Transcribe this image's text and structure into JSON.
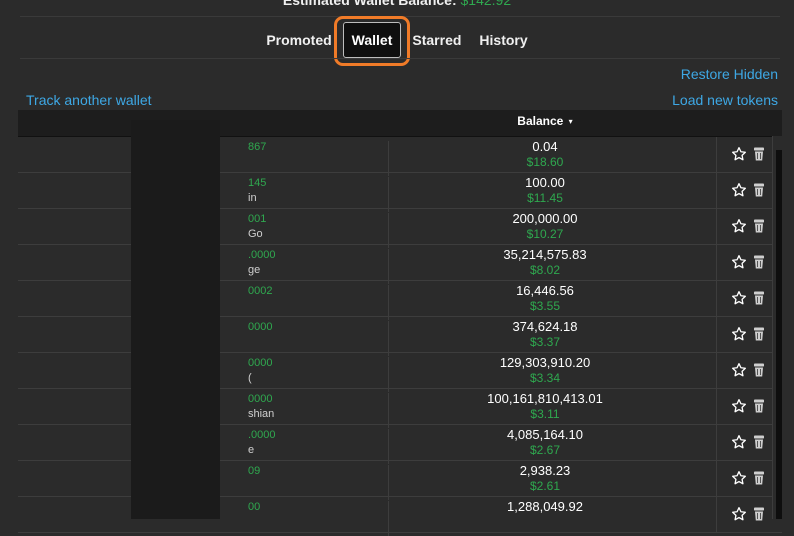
{
  "header": {
    "balance_label": "Estimated Wallet Balance:",
    "balance_value": "$142.92"
  },
  "tabs": [
    {
      "label": "Promoted"
    },
    {
      "label": "Wallet",
      "active": true
    },
    {
      "label": "Starred"
    },
    {
      "label": "History"
    }
  ],
  "links": {
    "restore_hidden": "Restore Hidden",
    "track_wallet": "Track another wallet",
    "load_tokens": "Load new tokens"
  },
  "table": {
    "balance_header": "Balance",
    "sort_caret": "▾",
    "rows": [
      {
        "addr": "867",
        "name": "",
        "balance": "0.04",
        "usd": "$18.60"
      },
      {
        "addr": "145",
        "name": "in",
        "balance": "100.00",
        "usd": "$11.45"
      },
      {
        "addr": "001",
        "name": "Go",
        "balance": "200,000.00",
        "usd": "$10.27"
      },
      {
        "addr": ".0000",
        "name": "ge",
        "balance": "35,214,575.83",
        "usd": "$8.02"
      },
      {
        "addr": "0002",
        "name": "",
        "balance": "16,446.56",
        "usd": "$3.55"
      },
      {
        "addr": "0000",
        "name": "",
        "balance": "374,624.18",
        "usd": "$3.37"
      },
      {
        "addr": "0000",
        "name": "(",
        "balance": "129,303,910.20",
        "usd": "$3.34"
      },
      {
        "addr": "0000",
        "name": "shian",
        "balance": "100,161,810,413.01",
        "usd": "$3.11"
      },
      {
        "addr": ".0000",
        "name": "e",
        "balance": "4,085,164.10",
        "usd": "$2.67"
      },
      {
        "addr": "09",
        "name": "",
        "balance": "2,938.23",
        "usd": "$2.61"
      },
      {
        "addr": "00",
        "name": "",
        "balance": "1,288,049.92",
        "usd": ""
      }
    ]
  },
  "icons": {
    "star": "star-outline-icon",
    "trash": "trash-icon"
  },
  "colors": {
    "accent_green": "#2fa84f",
    "link_blue": "#3ea8e5",
    "highlight_orange": "#f07b28"
  }
}
